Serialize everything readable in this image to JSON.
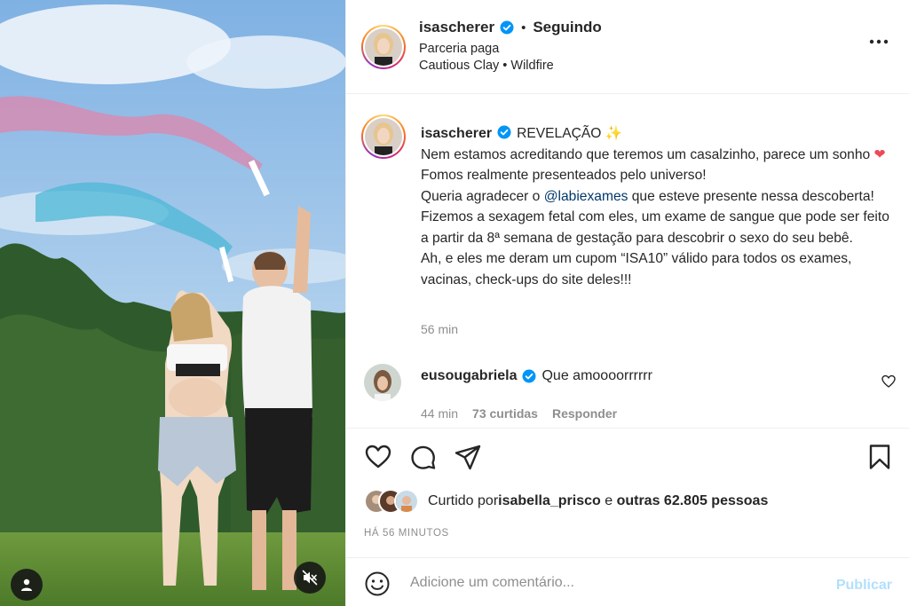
{
  "colors": {
    "verified": "#0095f6",
    "link": "#00376b",
    "muted": "#8e8e8e",
    "publish_disabled": "#b2dffc",
    "heart_red": "#ed4956"
  },
  "header": {
    "username": "isascherer",
    "separator": "•",
    "follow_status": "Seguindo",
    "paid_partnership": "Parceria paga",
    "music": "Cautious Clay • Wildfire",
    "more_icon": "more-horizontal-icon"
  },
  "caption": {
    "username": "isascherer",
    "title": "REVELAÇÃO",
    "sparkle": "✨",
    "line1": "Nem estamos acreditando que teremos um casalzinho, parece um sonho ",
    "heart": "❤",
    "line2": " Fomos realmente presenteados pelo universo!",
    "line3_pre": "Queria agradecer o ",
    "mention": "@labiexames",
    "line3_post": " que esteve presente nessa descoberta! Fizemos a sexagem fetal com eles, um exame de sangue que pode ser feito a partir da 8ª semana de gestação para descobrir o sexo do seu bebê.",
    "line4": "Ah, e eles me deram um cupom “ISA10” válido para todos os exames, vacinas, check-ups do site deles!!!",
    "time": "56 min"
  },
  "comment": {
    "username": "eusougabriela",
    "text": "Que amoooorrrrrr",
    "time": "44 min",
    "likes": "73 curtidas",
    "reply": "Responder"
  },
  "likes_line": {
    "prefix": "Curtido por ",
    "user": "isabella_prisco",
    "middle": " e ",
    "others": "outras 62.805 pessoas"
  },
  "time_ago": "HÁ 56 MINUTOS",
  "add_comment": {
    "placeholder": "Adicione um comentário...",
    "publish": "Publicar"
  }
}
